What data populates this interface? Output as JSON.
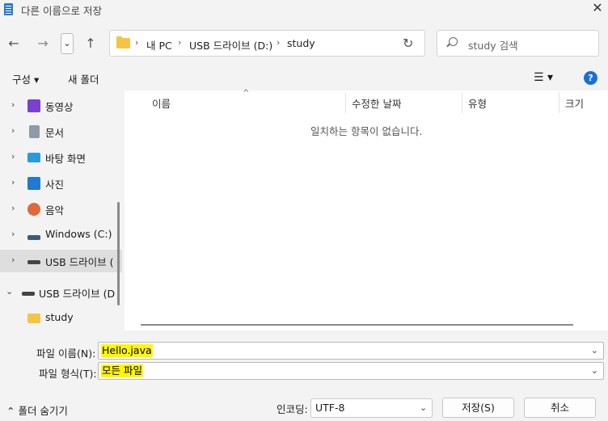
{
  "window": {
    "title": "다른 이름으로 저장",
    "close": "✕"
  },
  "nav": {
    "back": "←",
    "forward": "→",
    "recent": "⌄",
    "up": "↑",
    "refresh": "↻"
  },
  "address": {
    "crumbs": [
      "내 PC",
      "USB 드라이브 (D:)",
      "study"
    ],
    "sep": "›"
  },
  "search": {
    "placeholder": "study 검색"
  },
  "toolbar": {
    "organize": "구성 ▾",
    "new_folder": "새 폴더",
    "view": "☰ ▾",
    "help": "?"
  },
  "sidebar": {
    "items": [
      {
        "label": "동영상",
        "chev": "›"
      },
      {
        "label": "문서",
        "chev": "›"
      },
      {
        "label": "바탕 화면",
        "chev": "›"
      },
      {
        "label": "사진",
        "chev": "›"
      },
      {
        "label": "음악",
        "chev": "›"
      },
      {
        "label": "Windows (C:)",
        "chev": "›"
      },
      {
        "label": "USB 드라이브 (",
        "chev": "›"
      },
      {
        "label": "USB 드라이브 (D",
        "chev": "⌄"
      },
      {
        "label": "study",
        "chev": ""
      }
    ]
  },
  "columns": {
    "name": "이름",
    "modified": "수정한 날짜",
    "type": "유형",
    "size": "크기",
    "sort": "^"
  },
  "file_list": {
    "empty_message": "일치하는 항목이 없습니다."
  },
  "form": {
    "filename_label": "파일 이름(N):",
    "filename_value": "Hello.java",
    "filetype_label": "파일 형식(T):",
    "filetype_value": "모든 파일",
    "dropdown": "⌄"
  },
  "footer": {
    "hide_folders": "⌃ 폴더 숨기기",
    "encoding_label": "인코딩:",
    "encoding_value": "UTF-8",
    "save": "저장(S)",
    "cancel": "취소"
  },
  "colors": {
    "accent": "#1a6fd8",
    "highlight": "#fff700",
    "folder": "#f3c543"
  }
}
